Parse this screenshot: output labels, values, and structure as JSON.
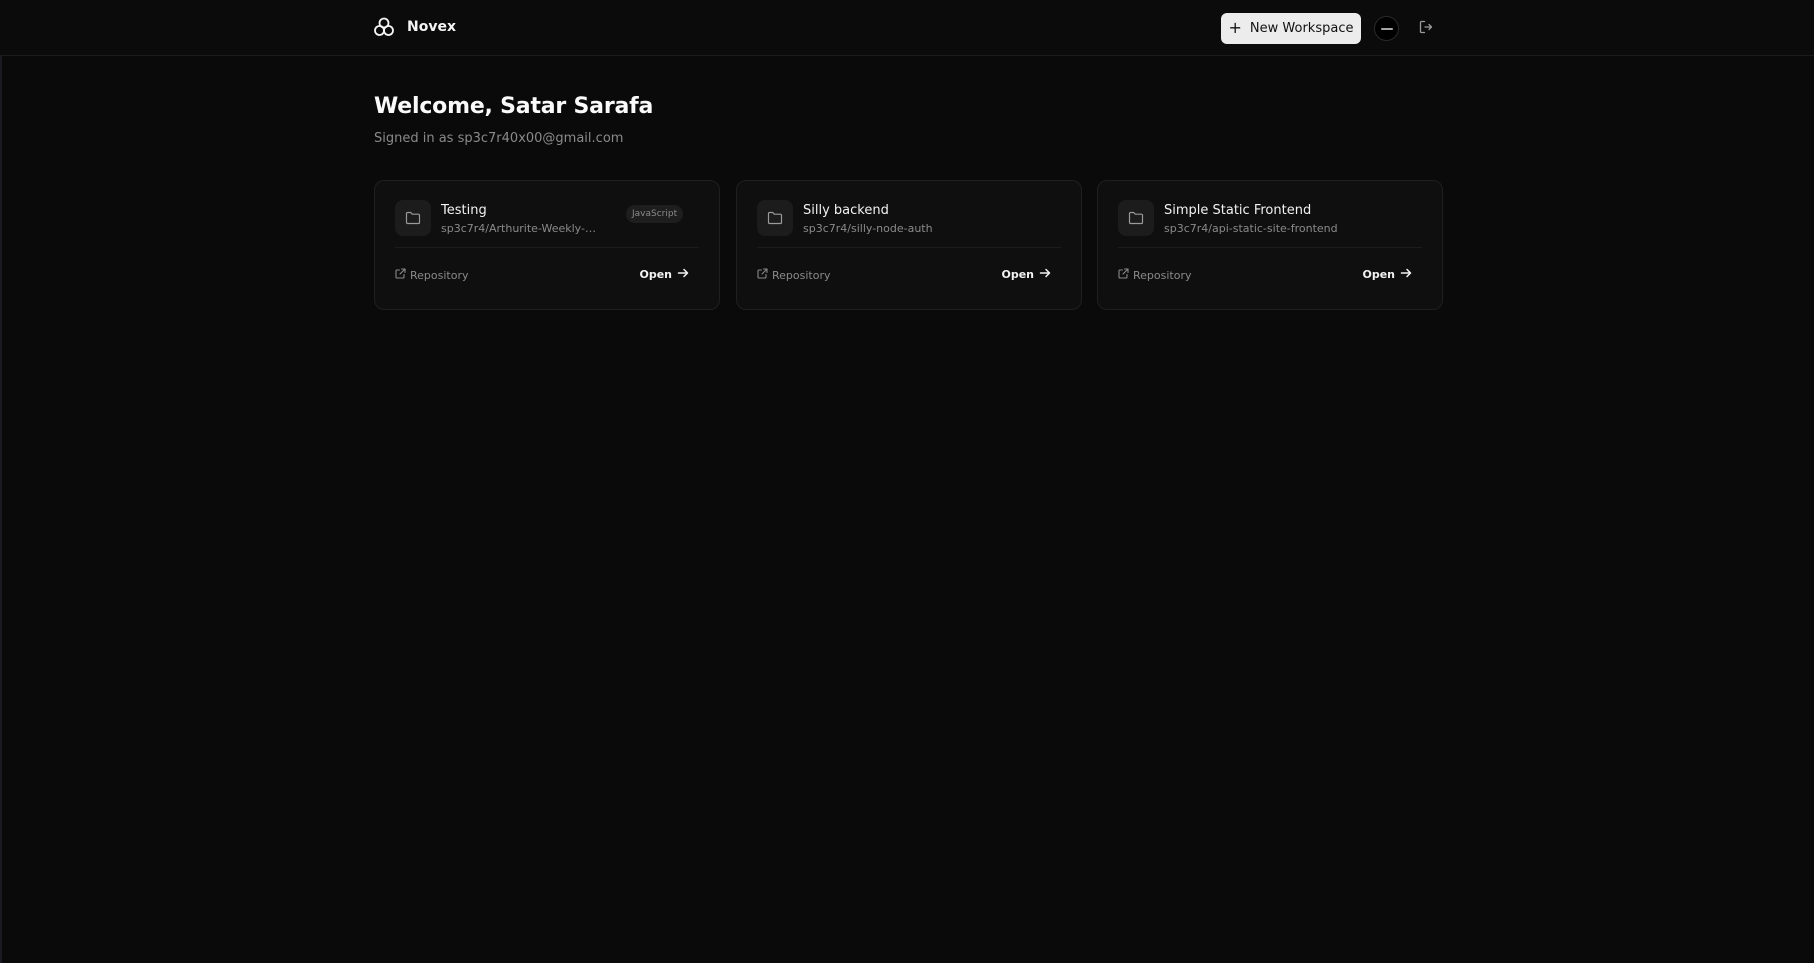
{
  "header": {
    "brand_name": "Novex",
    "new_workspace_label": "New Workspace",
    "icons": {
      "logo": "novex-logo-icon",
      "add": "plus-icon",
      "logout": "logout-icon"
    }
  },
  "main": {
    "welcome": "Welcome, Satar Sarafa",
    "signed_in": "Signed in as sp3c7r40x00@gmail.com"
  },
  "workspaces": [
    {
      "title": "Testing",
      "repo": "sp3c7r4/Arthurite-Weekly-R…",
      "language": "JavaScript",
      "repository_label": "Repository",
      "open_label": "Open"
    },
    {
      "title": "Silly backend",
      "repo": "sp3c7r4/silly-node-auth",
      "language": "",
      "repository_label": "Repository",
      "open_label": "Open"
    },
    {
      "title": "Simple Static Frontend",
      "repo": "sp3c7r4/api-static-site-frontend",
      "language": "",
      "repository_label": "Repository",
      "open_label": "Open"
    }
  ],
  "colors": {
    "background": "#0a0a0a",
    "card": "#0f0f0f",
    "primary_button": "#ececec",
    "muted_text": "#8a8a8a"
  }
}
